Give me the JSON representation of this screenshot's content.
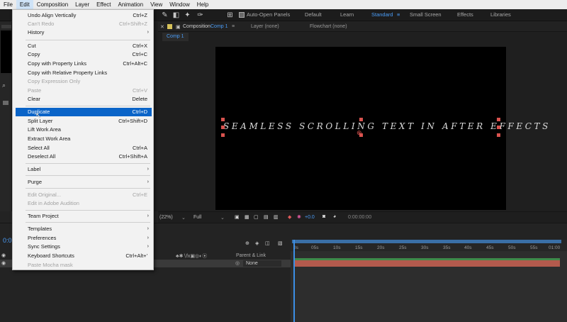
{
  "menubar": {
    "items": [
      "File",
      "Edit",
      "Composition",
      "Layer",
      "Effect",
      "Animation",
      "View",
      "Window",
      "Help"
    ]
  },
  "toolbar": {
    "auto_open_panels": "Auto-Open Panels",
    "workspaces": [
      "Default",
      "Learn",
      "Standard",
      "Small Screen",
      "Effects",
      "Libraries"
    ],
    "active_workspace": "Standard"
  },
  "edit_menu": {
    "items": [
      {
        "label": "Undo Align Vertically",
        "shortcut": "Ctrl+Z"
      },
      {
        "label": "Can't Redo",
        "shortcut": "Ctrl+Shift+Z"
      },
      {
        "label": "History"
      },
      {
        "label": "Cut",
        "shortcut": "Ctrl+X"
      },
      {
        "label": "Copy",
        "shortcut": "Ctrl+C"
      },
      {
        "label": "Copy with Property Links",
        "shortcut": "Ctrl+Alt+C"
      },
      {
        "label": "Copy with Relative Property Links"
      },
      {
        "label": "Copy Expression Only"
      },
      {
        "label": "Paste",
        "shortcut": "Ctrl+V"
      },
      {
        "label": "Clear",
        "shortcut": "Delete"
      },
      {
        "label": "Duplicate",
        "shortcut": "Ctrl+D"
      },
      {
        "label": "Split Layer",
        "shortcut": "Ctrl+Shift+D"
      },
      {
        "label": "Lift Work Area"
      },
      {
        "label": "Extract Work Area"
      },
      {
        "label": "Select All",
        "shortcut": "Ctrl+A"
      },
      {
        "label": "Deselect All",
        "shortcut": "Ctrl+Shift+A"
      },
      {
        "label": "Label"
      },
      {
        "label": "Purge"
      },
      {
        "label": "Edit Original...",
        "shortcut": "Ctrl+E"
      },
      {
        "label": "Edit in Adobe Audition"
      },
      {
        "label": "Team Project"
      },
      {
        "label": "Templates"
      },
      {
        "label": "Preferences"
      },
      {
        "label": "Sync Settings"
      },
      {
        "label": "Keyboard Shortcuts",
        "shortcut": "Ctrl+Alt+'"
      },
      {
        "label": "Paste Mocha mask"
      }
    ]
  },
  "composition": {
    "panel_label": "Composition",
    "comp_name": "Comp 1",
    "layer_label": "Layer (none)",
    "flowchart_label": "Flowchart (none)",
    "subtab": "Comp 1",
    "title_text": "SEAMLESS SCROLLING TEXT IN AFTER EFFECTS"
  },
  "viewer_bar": {
    "zoom": "(22%)",
    "resolution": "Full",
    "exposure": "+0.0",
    "timecode": "0:00:00:00"
  },
  "timeline": {
    "ticks": [
      "0s",
      "05s",
      "10s",
      "15s",
      "20s",
      "25s",
      "30s",
      "35s",
      "40s",
      "45s",
      "50s",
      "55s",
      "01:00"
    ],
    "parent_link": "Parent & Link",
    "parent_value": "None",
    "current_time": "0:0"
  },
  "colors": {
    "highlight": "#0a64c8",
    "accent": "#4a9df8",
    "layer_bar": "#b35a4d"
  }
}
